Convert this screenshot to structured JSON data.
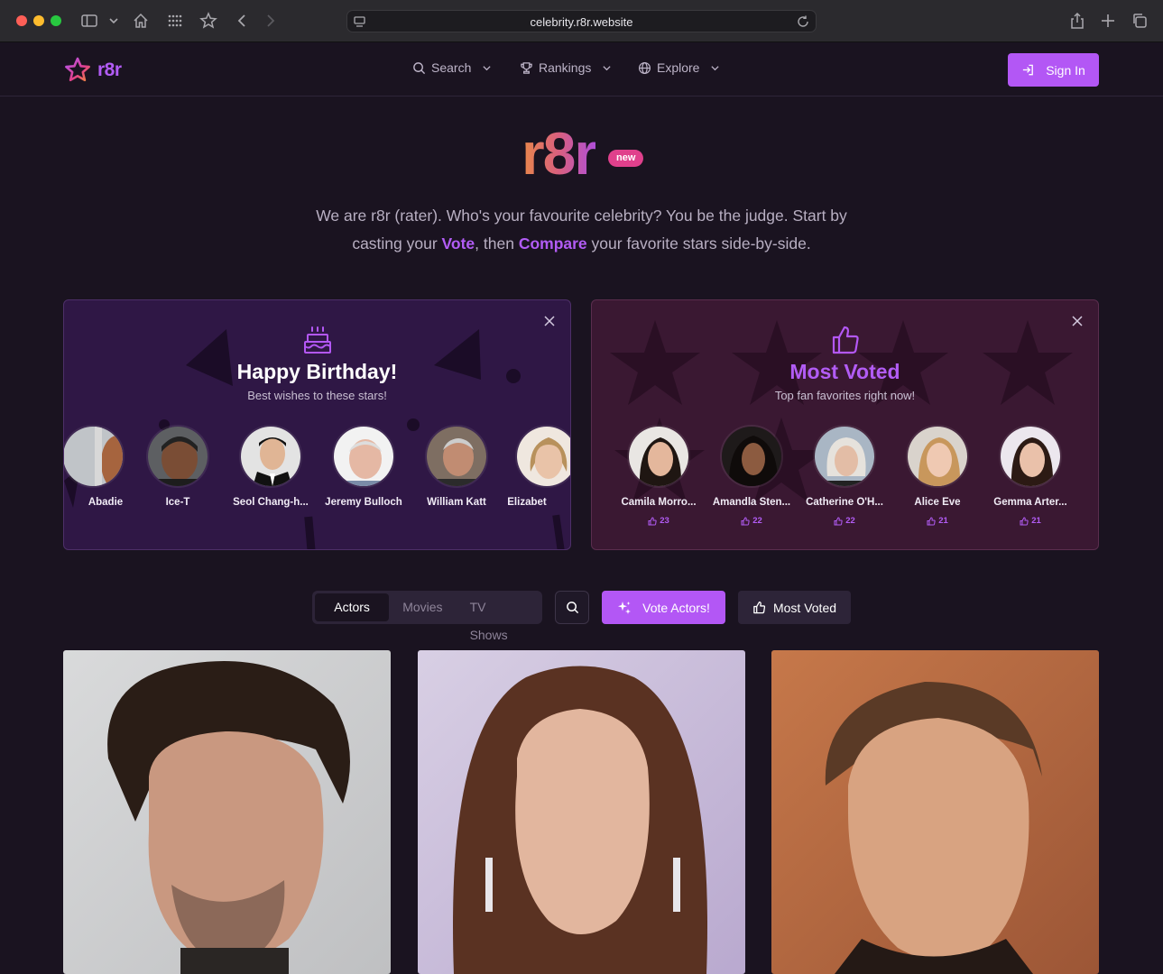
{
  "browser": {
    "url": "celebrity.r8r.website"
  },
  "header": {
    "logo_text": "r8r",
    "nav": [
      {
        "label": "Search",
        "icon": "search-icon"
      },
      {
        "label": "Rankings",
        "icon": "trophy-icon"
      },
      {
        "label": "Explore",
        "icon": "globe-icon"
      }
    ],
    "signin_label": "Sign In"
  },
  "hero": {
    "title": "r8r",
    "badge": "new",
    "text_1": "We are r8r (rater). Who's your favourite celebrity? You be the judge. Start by casting your ",
    "highlight_1": "Vote",
    "text_2": ", then ",
    "highlight_2": "Compare",
    "text_3": " your favorite stars side-by-side."
  },
  "birthday": {
    "title": "Happy Birthday!",
    "subtitle": "Best wishes to these stars!",
    "people": [
      {
        "name": "Abadie"
      },
      {
        "name": "Ice-T"
      },
      {
        "name": "Seol Chang-h..."
      },
      {
        "name": "Jeremy Bulloch"
      },
      {
        "name": "William Katt"
      },
      {
        "name": "Elizabet"
      }
    ]
  },
  "most_voted": {
    "title": "Most Voted",
    "subtitle": "Top fan favorites right now!",
    "people": [
      {
        "name": "Camila Morro...",
        "votes": "23"
      },
      {
        "name": "Amandla Sten...",
        "votes": "22"
      },
      {
        "name": "Catherine O'H...",
        "votes": "22"
      },
      {
        "name": "Alice Eve",
        "votes": "21"
      },
      {
        "name": "Gemma Arter...",
        "votes": "21"
      }
    ]
  },
  "toolbar": {
    "tabs": [
      "Actors",
      "Movies",
      "TV Shows"
    ],
    "active_tab": "Actors",
    "vote_label": "Vote Actors!",
    "most_voted_label": "Most Voted"
  },
  "colors": {
    "accent": "#b357f5",
    "background": "#1a1320",
    "badge": "#e0408c"
  }
}
